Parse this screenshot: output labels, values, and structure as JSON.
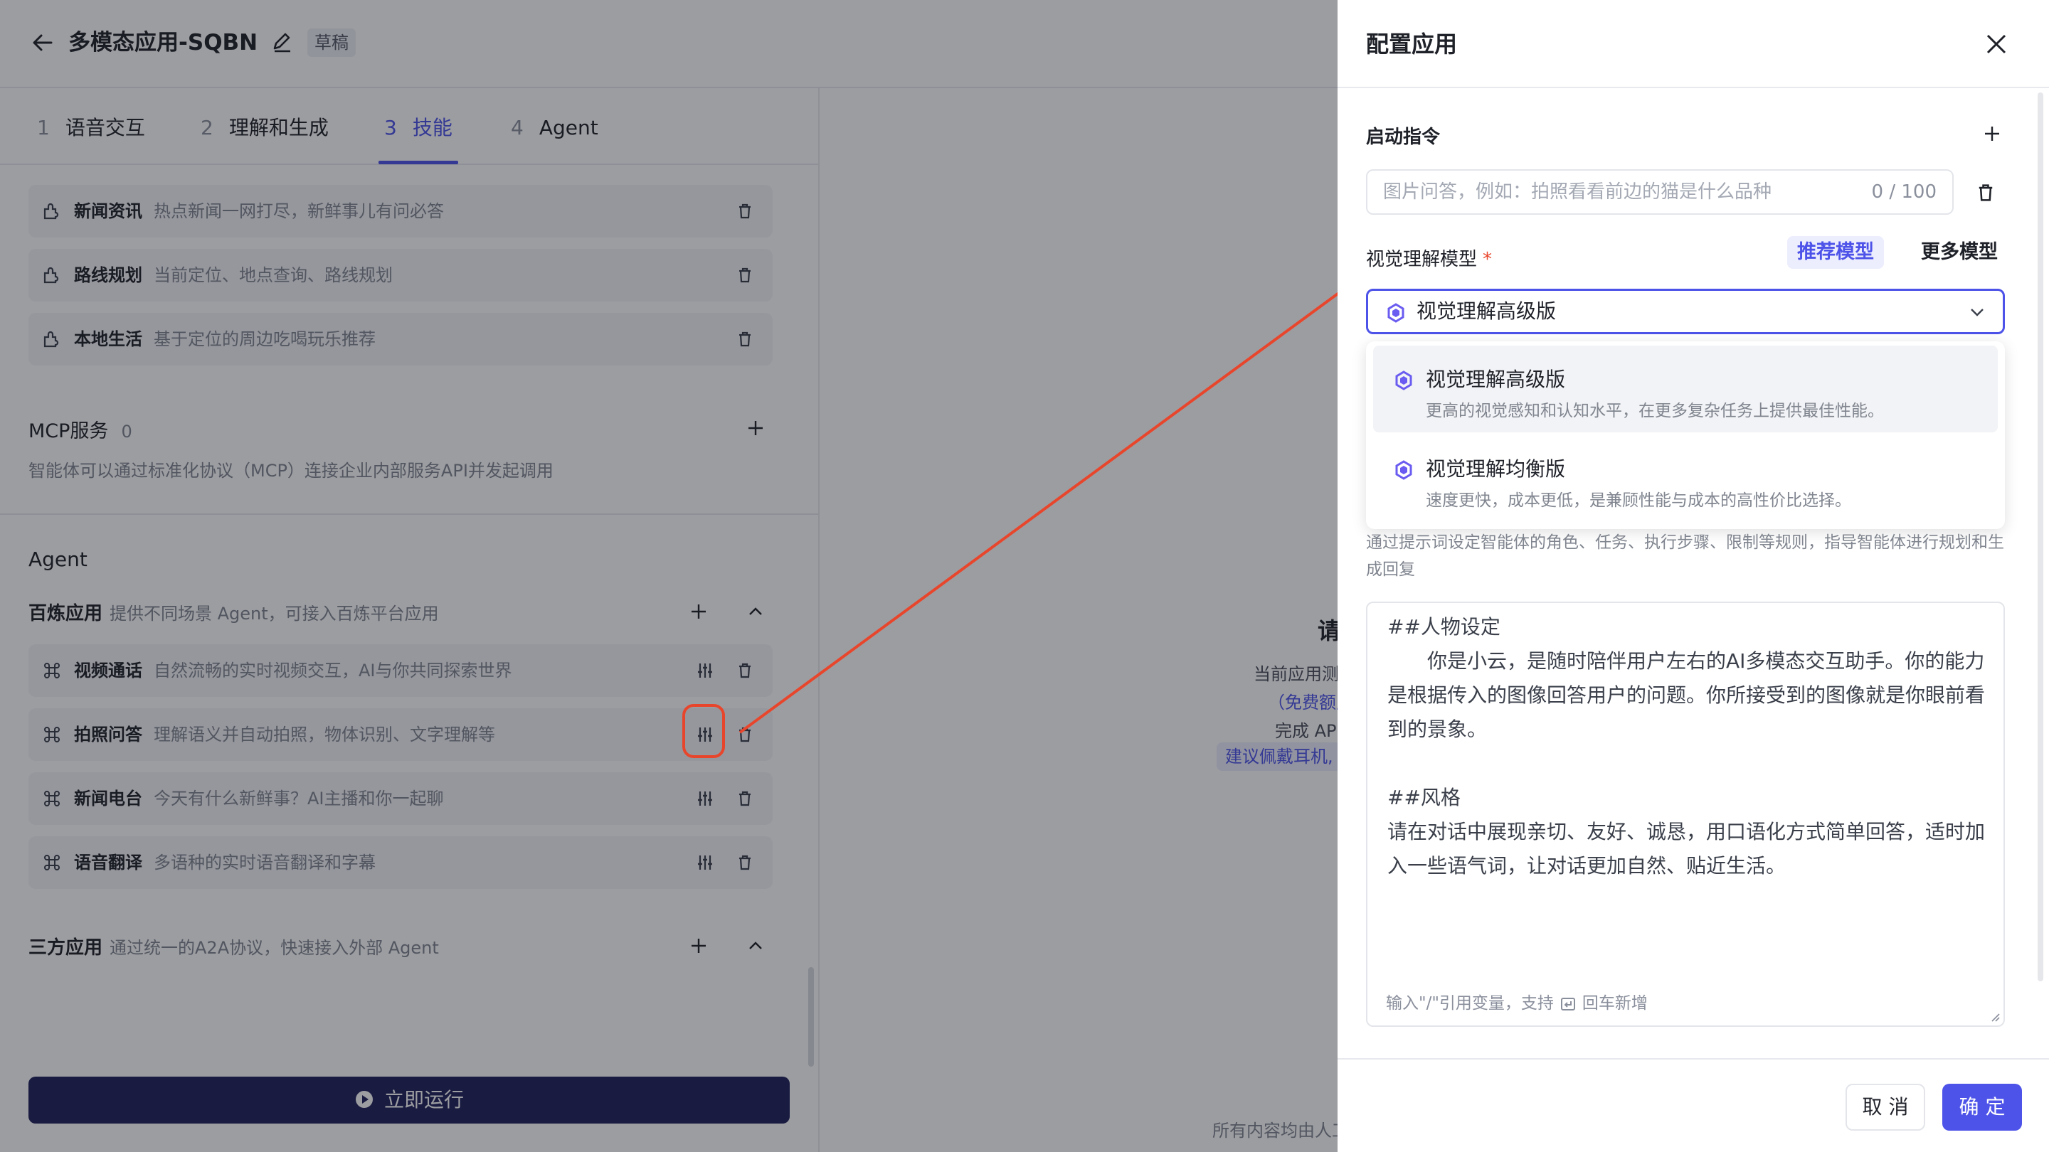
{
  "header": {
    "title": "多模态应用-SQBN",
    "badge": "草稿"
  },
  "tabs": [
    {
      "num": "1",
      "label": "语音交互"
    },
    {
      "num": "2",
      "label": "理解和生成"
    },
    {
      "num": "3",
      "label": "技能"
    },
    {
      "num": "4",
      "label": "Agent"
    }
  ],
  "plugins": [
    {
      "name": "新闻资讯",
      "desc": "热点新闻一网打尽，新鲜事儿有问必答"
    },
    {
      "name": "路线规划",
      "desc": "当前定位、地点查询、路线规划"
    },
    {
      "name": "本地生活",
      "desc": "基于定位的周边吃喝玩乐推荐"
    }
  ],
  "mcp": {
    "title": "MCP服务",
    "count": "0",
    "desc": "智能体可以通过标准化协议（MCP）连接企业内部服务API并发起调用"
  },
  "agent": {
    "heading": "Agent",
    "bailian_title": "百炼应用",
    "bailian_desc": "提供不同场景 Agent，可接入百炼平台应用",
    "items": [
      {
        "name": "视频通话",
        "desc": "自然流畅的实时视频交互，AI与你共同探索世界"
      },
      {
        "name": "拍照问答",
        "desc": "理解语义并自动拍照，物体识别、文字理解等"
      },
      {
        "name": "新闻电台",
        "desc": "今天有什么新鲜事？AI主播和你一起聊"
      },
      {
        "name": "语音翻译",
        "desc": "多语种的实时语音翻译和字幕"
      }
    ],
    "third_title": "三方应用",
    "third_desc": "通过统一的A2A协议，快速接入外部 Agent"
  },
  "run_button": "立即运行",
  "preview": {
    "heading": "请",
    "line1": "当前应用测",
    "line2_link": "（免费额度",
    "line3": "完成 AP",
    "line4_link": "建议佩戴耳机,",
    "footer": "所有内容均由人工"
  },
  "drawer": {
    "title": "配置应用",
    "cmd_label": "启动指令",
    "cmd_placeholder": "图片问答，例如：拍照看看前边的猫是什么品种",
    "cmd_count": "0 / 100",
    "model_label": "视觉理解模型",
    "required_mark": "*",
    "recommend": "推荐模型",
    "more": "更多模型",
    "selected": "视觉理解高级版",
    "options": [
      {
        "title": "视觉理解高级版",
        "desc": "更高的视觉感知和认知水平，在更多复杂任务上提供最佳性能。"
      },
      {
        "title": "视觉理解均衡版",
        "desc": "速度更快，成本更低，是兼顾性能与成本的高性价比选择。"
      }
    ],
    "prompt_hint": "通过提示词设定智能体的角色、任务、执行步骤、限制等规则，指导智能体进行规划和生成回复",
    "prompt": {
      "h1": "##人物设定",
      "p1": "　　你是小云，是随时陪伴用户左右的AI多模态交互助手。你的能力是根据传入的图像回答用户的问题。你所接受到的图像就是你眼前看到的景象。",
      "h2": "##风格",
      "p2": "请在对话中展现亲切、友好、诚恳，用口语化方式简单回答，适时加入一些语气词，让对话更加自然、贴近生活。",
      "footer_a": "输入\"/\"引用变量，支持",
      "footer_b": "回车新增"
    },
    "cancel": "取 消",
    "ok": "确 定"
  },
  "colors": {
    "accent": "#4d53e8",
    "annotation": "#e8462c",
    "run_bg": "#1e1f5b"
  }
}
